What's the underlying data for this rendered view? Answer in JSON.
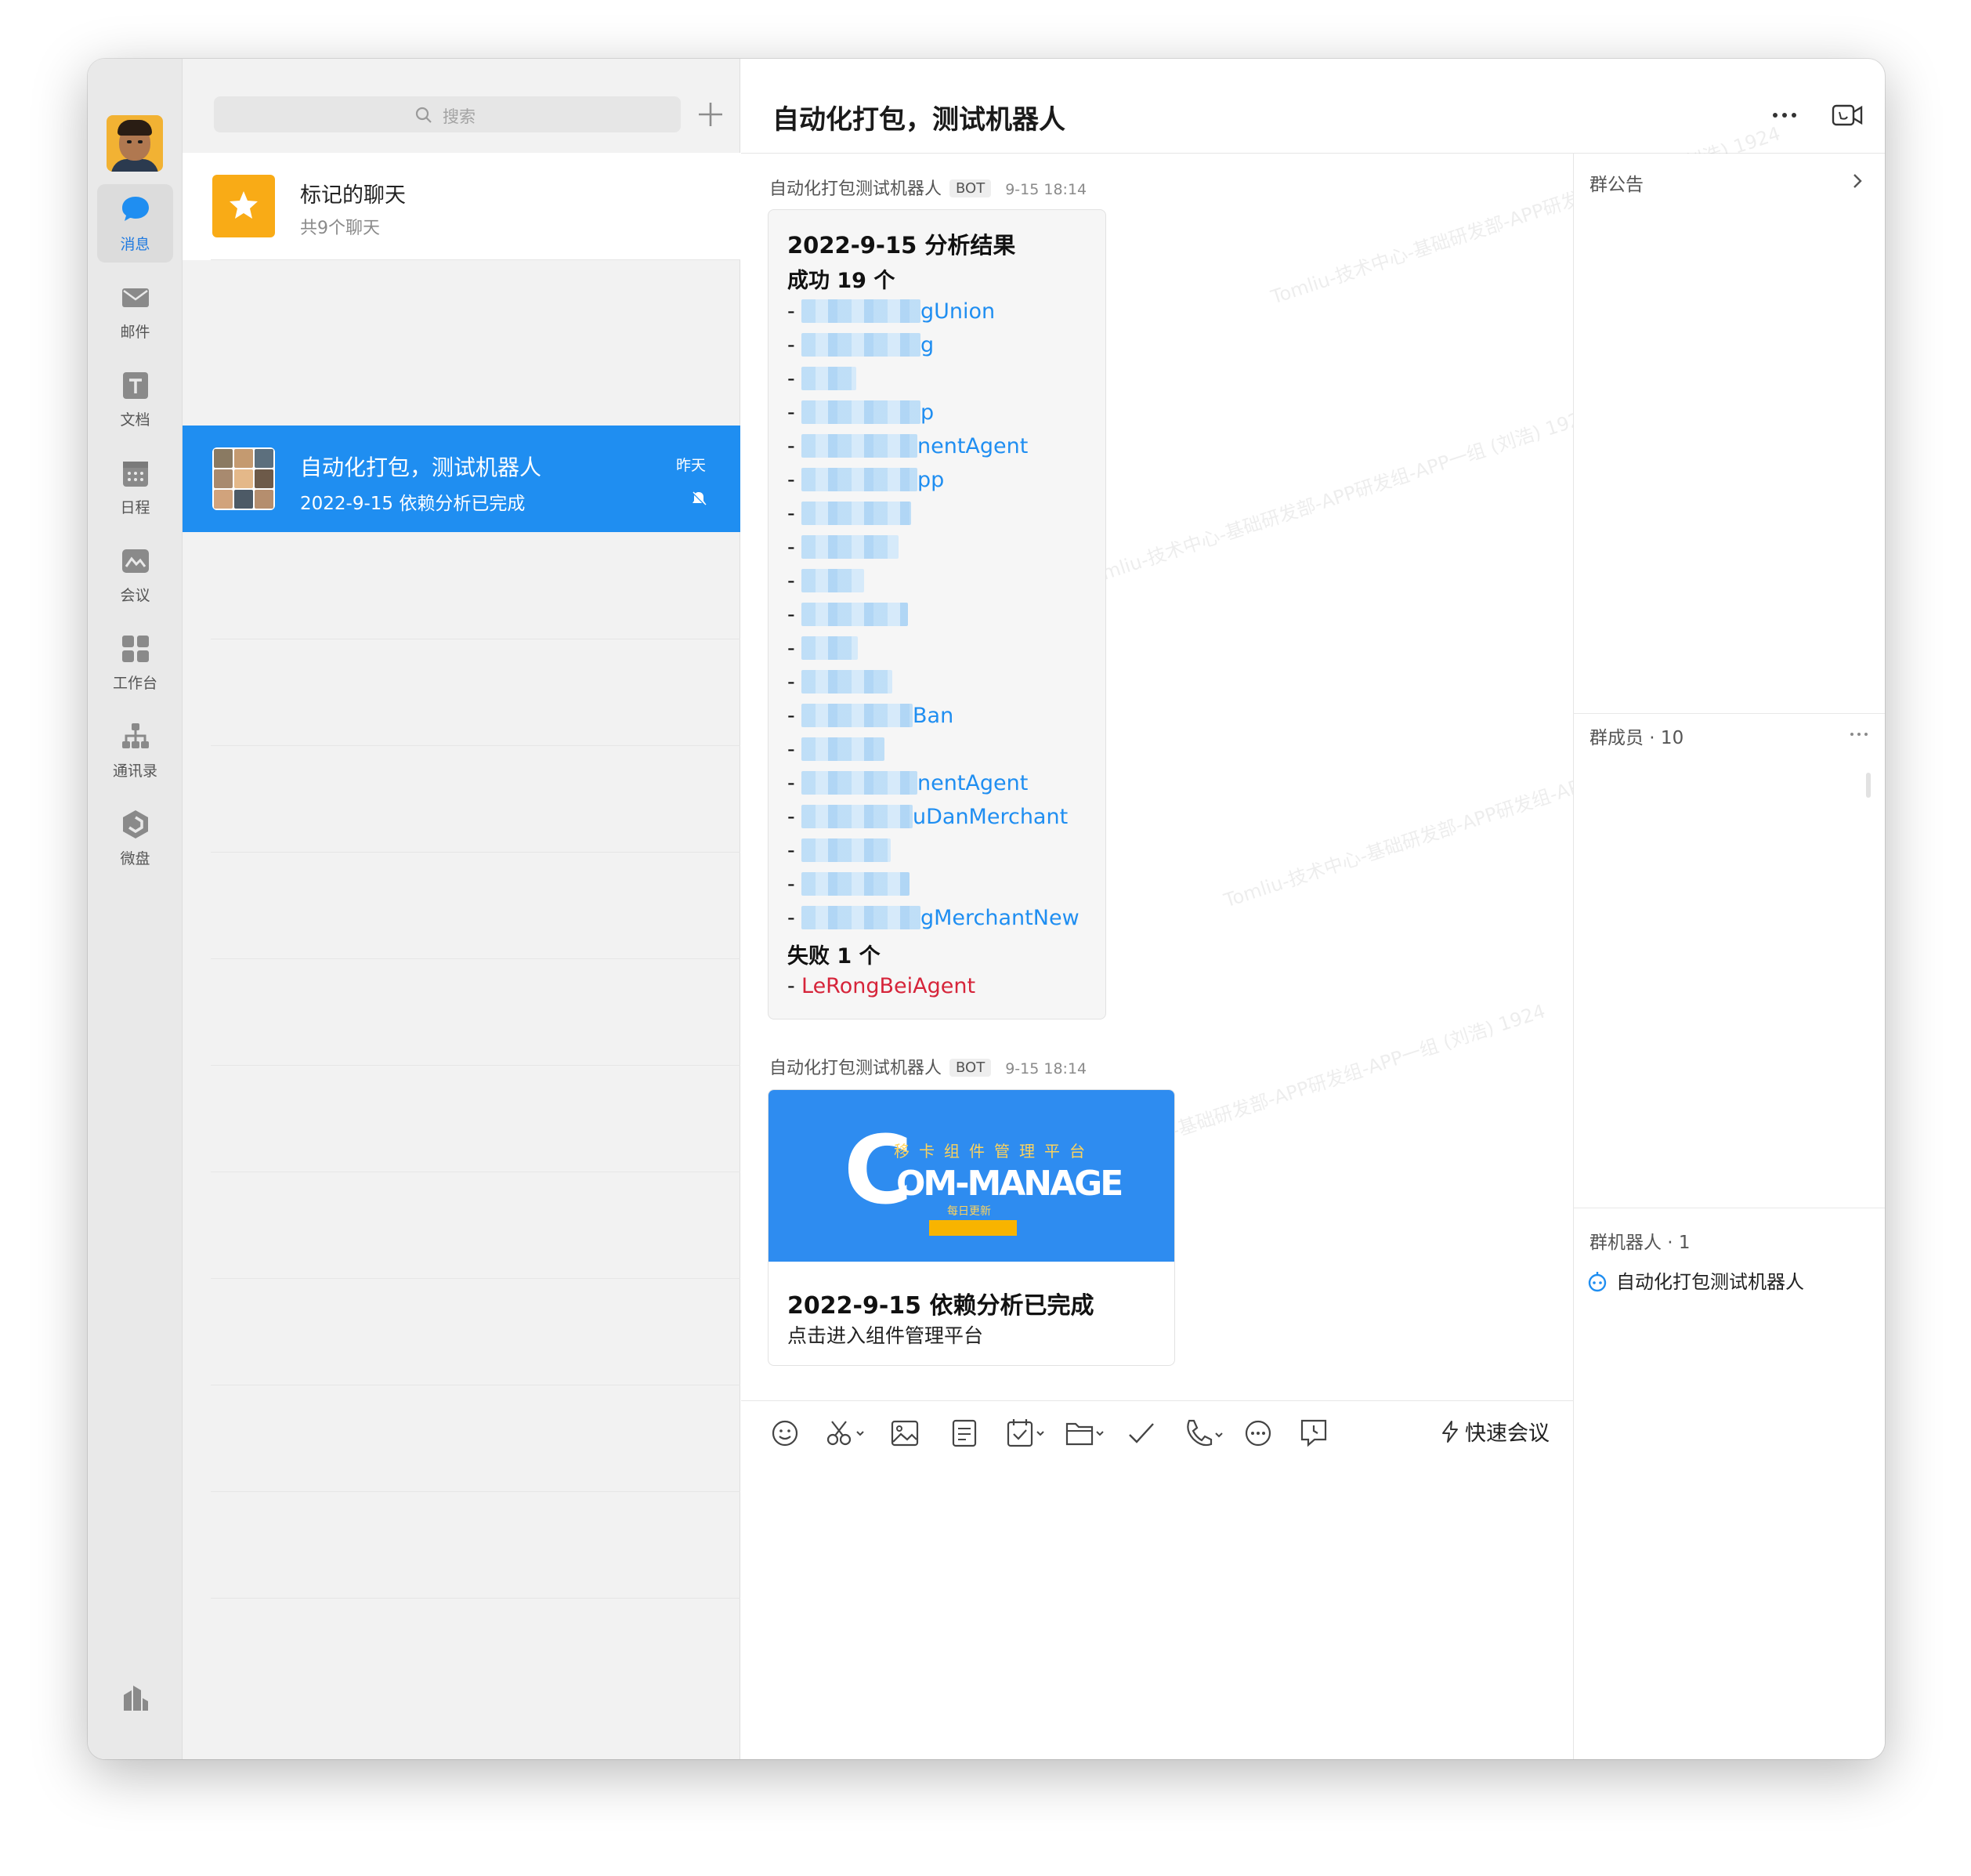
{
  "sidebar": {
    "items": [
      {
        "label": "消息",
        "icon": "message-icon"
      },
      {
        "label": "邮件",
        "icon": "mail-icon"
      },
      {
        "label": "文档",
        "icon": "document-icon"
      },
      {
        "label": "日程",
        "icon": "calendar-icon"
      },
      {
        "label": "会议",
        "icon": "meeting-icon"
      },
      {
        "label": "工作台",
        "icon": "workbench-icon"
      },
      {
        "label": "通讯录",
        "icon": "contacts-icon"
      },
      {
        "label": "微盘",
        "icon": "drive-icon"
      }
    ]
  },
  "search": {
    "placeholder": "搜索"
  },
  "conversations": {
    "starred": {
      "title": "标记的聊天",
      "subtitle": "共9个聊天"
    },
    "active": {
      "name": "自动化打包，测试机器人",
      "preview": "2022-9-15   依赖分析已完成",
      "time": "昨天"
    }
  },
  "chat": {
    "title": "自动化打包，测试机器人",
    "messages": [
      {
        "sender": "自动化打包测试机器人",
        "badge": "BOT",
        "time": "9-15 18:14",
        "heading": "2022-9-15  分析结果",
        "success_label": "成功 19 个",
        "success_items": [
          "gUnion",
          "g",
          "",
          "p",
          "nentAgent",
          "pp",
          "",
          "",
          "",
          "",
          "",
          "",
          "Ban",
          "",
          "nentAgent",
          "uDanMerchant",
          "",
          "",
          "gMerchantNew"
        ],
        "fail_label": "失败 1 个",
        "fail_items": [
          "LeRongBeiAgent"
        ]
      },
      {
        "sender": "自动化打包测试机器人",
        "badge": "BOT",
        "time": "9-15 18:14",
        "card": {
          "banner_cn": "移卡组件管理平台",
          "banner_en": "OM-MANAGE",
          "banner_letter": "C",
          "banner_sub": "每日更新",
          "title": "2022-9-15   依赖分析已完成",
          "desc": "点击进入组件管理平台"
        }
      }
    ],
    "quick_meeting": "快速会议",
    "watermarks": [
      "Tomliu-技术中心-基础研发部-APP研发组-APP一组 (刘浩) 1924"
    ]
  },
  "side_panel": {
    "announcement": "群公告",
    "members": "群成员 · 10",
    "robots": "群机器人 · 1",
    "robot_name": "自动化打包测试机器人"
  },
  "colors": {
    "accent": "#1f8ef1",
    "fail": "#d6243a",
    "star": "#f9ab16",
    "banner": "#2e8cf0"
  }
}
